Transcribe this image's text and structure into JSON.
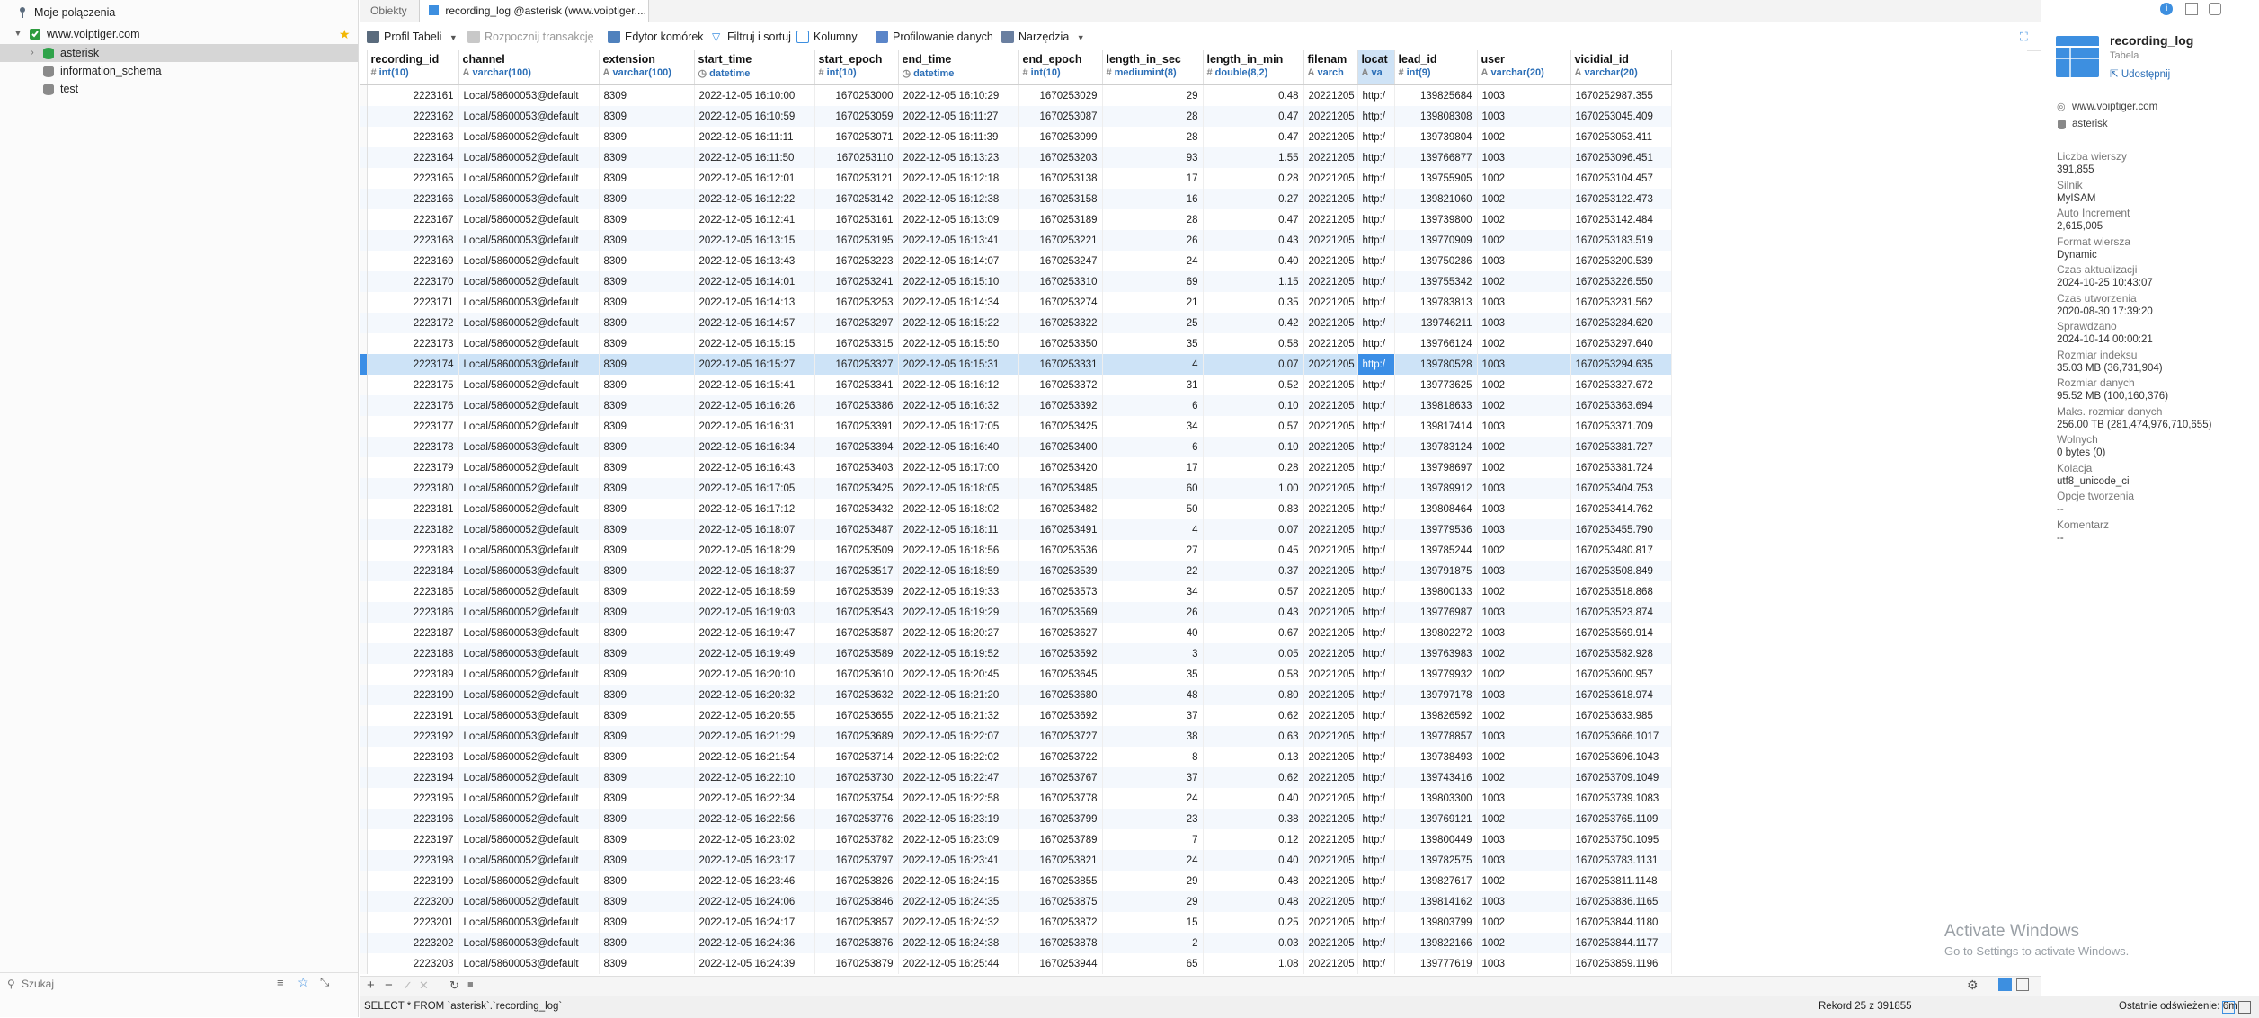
{
  "sidebar": {
    "header": "Moje połączenia",
    "connection": "www.voiptiger.com",
    "databases": [
      "asterisk",
      "information_schema",
      "test"
    ],
    "search_placeholder": "Szukaj"
  },
  "tabs": [
    "Obiekty",
    "recording_log @asterisk (www.voiptiger...."
  ],
  "toolbar": {
    "profile": "Profil Tabeli",
    "transaction": "Rozpocznij transakcję",
    "cell_editor": "Edytor komórek",
    "filter_sort": "Filtruj i sortuj",
    "columns": "Kolumny",
    "data_profiling": "Profilowanie danych",
    "tools": "Narzędzia"
  },
  "columns": [
    {
      "name": "recording_id",
      "type": "int(10)",
      "icon": "#"
    },
    {
      "name": "channel",
      "type": "varchar(100)",
      "icon": "A"
    },
    {
      "name": "extension",
      "type": "varchar(100)",
      "icon": "A"
    },
    {
      "name": "start_time",
      "type": "datetime",
      "icon": "◷"
    },
    {
      "name": "start_epoch",
      "type": "int(10)",
      "icon": "#"
    },
    {
      "name": "end_time",
      "type": "datetime",
      "icon": "◷"
    },
    {
      "name": "end_epoch",
      "type": "int(10)",
      "icon": "#"
    },
    {
      "name": "length_in_sec",
      "type": "mediumint(8)",
      "icon": "#"
    },
    {
      "name": "length_in_min",
      "type": "double(8,2)",
      "icon": "#"
    },
    {
      "name": "filenam",
      "type": "varch",
      "icon": "A"
    },
    {
      "name": "locat",
      "type": "va",
      "icon": "A"
    },
    {
      "name": "lead_id",
      "type": "int(9)",
      "icon": "#"
    },
    {
      "name": "user",
      "type": "varchar(20)",
      "icon": "A"
    },
    {
      "name": "vicidial_id",
      "type": "varchar(20)",
      "icon": "A"
    }
  ],
  "rows": [
    [
      "2223161",
      "Local/58600053@default",
      "8309",
      "2022-12-05 16:10:00",
      "1670253000",
      "2022-12-05 16:10:29",
      "1670253029",
      "29",
      "0.48",
      "20221205",
      "http:/",
      "139825684",
      "1003",
      "1670252987.355"
    ],
    [
      "2223162",
      "Local/58600053@default",
      "8309",
      "2022-12-05 16:10:59",
      "1670253059",
      "2022-12-05 16:11:27",
      "1670253087",
      "28",
      "0.47",
      "20221205",
      "http:/",
      "139808308",
      "1003",
      "1670253045.409"
    ],
    [
      "2223163",
      "Local/58600052@default",
      "8309",
      "2022-12-05 16:11:11",
      "1670253071",
      "2022-12-05 16:11:39",
      "1670253099",
      "28",
      "0.47",
      "20221205",
      "http:/",
      "139739804",
      "1002",
      "1670253053.411"
    ],
    [
      "2223164",
      "Local/58600052@default",
      "8309",
      "2022-12-05 16:11:50",
      "1670253110",
      "2022-12-05 16:13:23",
      "1670253203",
      "93",
      "1.55",
      "20221205",
      "http:/",
      "139766877",
      "1003",
      "1670253096.451"
    ],
    [
      "2223165",
      "Local/58600052@default",
      "8309",
      "2022-12-05 16:12:01",
      "1670253121",
      "2022-12-05 16:12:18",
      "1670253138",
      "17",
      "0.28",
      "20221205",
      "http:/",
      "139755905",
      "1002",
      "1670253104.457"
    ],
    [
      "2223166",
      "Local/58600053@default",
      "8309",
      "2022-12-05 16:12:22",
      "1670253142",
      "2022-12-05 16:12:38",
      "1670253158",
      "16",
      "0.27",
      "20221205",
      "http:/",
      "139821060",
      "1002",
      "1670253122.473"
    ],
    [
      "2223167",
      "Local/58600052@default",
      "8309",
      "2022-12-05 16:12:41",
      "1670253161",
      "2022-12-05 16:13:09",
      "1670253189",
      "28",
      "0.47",
      "20221205",
      "http:/",
      "139739800",
      "1002",
      "1670253142.484"
    ],
    [
      "2223168",
      "Local/58600053@default",
      "8309",
      "2022-12-05 16:13:15",
      "1670253195",
      "2022-12-05 16:13:41",
      "1670253221",
      "26",
      "0.43",
      "20221205",
      "http:/",
      "139770909",
      "1002",
      "1670253183.519"
    ],
    [
      "2223169",
      "Local/58600052@default",
      "8309",
      "2022-12-05 16:13:43",
      "1670253223",
      "2022-12-05 16:14:07",
      "1670253247",
      "24",
      "0.40",
      "20221205",
      "http:/",
      "139750286",
      "1003",
      "1670253200.539"
    ],
    [
      "2223170",
      "Local/58600052@default",
      "8309",
      "2022-12-05 16:14:01",
      "1670253241",
      "2022-12-05 16:15:10",
      "1670253310",
      "69",
      "1.15",
      "20221205",
      "http:/",
      "139755342",
      "1002",
      "1670253226.550"
    ],
    [
      "2223171",
      "Local/58600053@default",
      "8309",
      "2022-12-05 16:14:13",
      "1670253253",
      "2022-12-05 16:14:34",
      "1670253274",
      "21",
      "0.35",
      "20221205",
      "http:/",
      "139783813",
      "1003",
      "1670253231.562"
    ],
    [
      "2223172",
      "Local/58600052@default",
      "8309",
      "2022-12-05 16:14:57",
      "1670253297",
      "2022-12-05 16:15:22",
      "1670253322",
      "25",
      "0.42",
      "20221205",
      "http:/",
      "139746211",
      "1003",
      "1670253284.620"
    ],
    [
      "2223173",
      "Local/58600052@default",
      "8309",
      "2022-12-05 16:15:15",
      "1670253315",
      "2022-12-05 16:15:50",
      "1670253350",
      "35",
      "0.58",
      "20221205",
      "http:/",
      "139766124",
      "1002",
      "1670253297.640"
    ],
    [
      "2223174",
      "Local/58600053@default",
      "8309",
      "2022-12-05 16:15:27",
      "1670253327",
      "2022-12-05 16:15:31",
      "1670253331",
      "4",
      "0.07",
      "20221205",
      "http:/",
      "139780528",
      "1003",
      "1670253294.635"
    ],
    [
      "2223175",
      "Local/58600052@default",
      "8309",
      "2022-12-05 16:15:41",
      "1670253341",
      "2022-12-05 16:16:12",
      "1670253372",
      "31",
      "0.52",
      "20221205",
      "http:/",
      "139773625",
      "1002",
      "1670253327.672"
    ],
    [
      "2223176",
      "Local/58600052@default",
      "8309",
      "2022-12-05 16:16:26",
      "1670253386",
      "2022-12-05 16:16:32",
      "1670253392",
      "6",
      "0.10",
      "20221205",
      "http:/",
      "139818633",
      "1002",
      "1670253363.694"
    ],
    [
      "2223177",
      "Local/58600052@default",
      "8309",
      "2022-12-05 16:16:31",
      "1670253391",
      "2022-12-05 16:17:05",
      "1670253425",
      "34",
      "0.57",
      "20221205",
      "http:/",
      "139817414",
      "1003",
      "1670253371.709"
    ],
    [
      "2223178",
      "Local/58600053@default",
      "8309",
      "2022-12-05 16:16:34",
      "1670253394",
      "2022-12-05 16:16:40",
      "1670253400",
      "6",
      "0.10",
      "20221205",
      "http:/",
      "139783124",
      "1002",
      "1670253381.727"
    ],
    [
      "2223179",
      "Local/58600052@default",
      "8309",
      "2022-12-05 16:16:43",
      "1670253403",
      "2022-12-05 16:17:00",
      "1670253420",
      "17",
      "0.28",
      "20221205",
      "http:/",
      "139798697",
      "1002",
      "1670253381.724"
    ],
    [
      "2223180",
      "Local/58600052@default",
      "8309",
      "2022-12-05 16:17:05",
      "1670253425",
      "2022-12-05 16:18:05",
      "1670253485",
      "60",
      "1.00",
      "20221205",
      "http:/",
      "139789912",
      "1003",
      "1670253404.753"
    ],
    [
      "2223181",
      "Local/58600052@default",
      "8309",
      "2022-12-05 16:17:12",
      "1670253432",
      "2022-12-05 16:18:02",
      "1670253482",
      "50",
      "0.83",
      "20221205",
      "http:/",
      "139808464",
      "1003",
      "1670253414.762"
    ],
    [
      "2223182",
      "Local/58600052@default",
      "8309",
      "2022-12-05 16:18:07",
      "1670253487",
      "2022-12-05 16:18:11",
      "1670253491",
      "4",
      "0.07",
      "20221205",
      "http:/",
      "139779536",
      "1003",
      "1670253455.790"
    ],
    [
      "2223183",
      "Local/58600053@default",
      "8309",
      "2022-12-05 16:18:29",
      "1670253509",
      "2022-12-05 16:18:56",
      "1670253536",
      "27",
      "0.45",
      "20221205",
      "http:/",
      "139785244",
      "1002",
      "1670253480.817"
    ],
    [
      "2223184",
      "Local/58600053@default",
      "8309",
      "2022-12-05 16:18:37",
      "1670253517",
      "2022-12-05 16:18:59",
      "1670253539",
      "22",
      "0.37",
      "20221205",
      "http:/",
      "139791875",
      "1003",
      "1670253508.849"
    ],
    [
      "2223185",
      "Local/58600052@default",
      "8309",
      "2022-12-05 16:18:59",
      "1670253539",
      "2022-12-05 16:19:33",
      "1670253573",
      "34",
      "0.57",
      "20221205",
      "http:/",
      "139800133",
      "1002",
      "1670253518.868"
    ],
    [
      "2223186",
      "Local/58600052@default",
      "8309",
      "2022-12-05 16:19:03",
      "1670253543",
      "2022-12-05 16:19:29",
      "1670253569",
      "26",
      "0.43",
      "20221205",
      "http:/",
      "139776987",
      "1003",
      "1670253523.874"
    ],
    [
      "2223187",
      "Local/58600053@default",
      "8309",
      "2022-12-05 16:19:47",
      "1670253587",
      "2022-12-05 16:20:27",
      "1670253627",
      "40",
      "0.67",
      "20221205",
      "http:/",
      "139802272",
      "1003",
      "1670253569.914"
    ],
    [
      "2223188",
      "Local/58600053@default",
      "8309",
      "2022-12-05 16:19:49",
      "1670253589",
      "2022-12-05 16:19:52",
      "1670253592",
      "3",
      "0.05",
      "20221205",
      "http:/",
      "139763983",
      "1002",
      "1670253582.928"
    ],
    [
      "2223189",
      "Local/58600052@default",
      "8309",
      "2022-12-05 16:20:10",
      "1670253610",
      "2022-12-05 16:20:45",
      "1670253645",
      "35",
      "0.58",
      "20221205",
      "http:/",
      "139779932",
      "1002",
      "1670253600.957"
    ],
    [
      "2223190",
      "Local/58600052@default",
      "8309",
      "2022-12-05 16:20:32",
      "1670253632",
      "2022-12-05 16:21:20",
      "1670253680",
      "48",
      "0.80",
      "20221205",
      "http:/",
      "139797178",
      "1003",
      "1670253618.974"
    ],
    [
      "2223191",
      "Local/58600053@default",
      "8309",
      "2022-12-05 16:20:55",
      "1670253655",
      "2022-12-05 16:21:32",
      "1670253692",
      "37",
      "0.62",
      "20221205",
      "http:/",
      "139826592",
      "1002",
      "1670253633.985"
    ],
    [
      "2223192",
      "Local/58600053@default",
      "8309",
      "2022-12-05 16:21:29",
      "1670253689",
      "2022-12-05 16:22:07",
      "1670253727",
      "38",
      "0.63",
      "20221205",
      "http:/",
      "139778857",
      "1003",
      "1670253666.1017"
    ],
    [
      "2223193",
      "Local/58600052@default",
      "8309",
      "2022-12-05 16:21:54",
      "1670253714",
      "2022-12-05 16:22:02",
      "1670253722",
      "8",
      "0.13",
      "20221205",
      "http:/",
      "139738493",
      "1002",
      "1670253696.1043"
    ],
    [
      "2223194",
      "Local/58600052@default",
      "8309",
      "2022-12-05 16:22:10",
      "1670253730",
      "2022-12-05 16:22:47",
      "1670253767",
      "37",
      "0.62",
      "20221205",
      "http:/",
      "139743416",
      "1002",
      "1670253709.1049"
    ],
    [
      "2223195",
      "Local/58600052@default",
      "8309",
      "2022-12-05 16:22:34",
      "1670253754",
      "2022-12-05 16:22:58",
      "1670253778",
      "24",
      "0.40",
      "20221205",
      "http:/",
      "139803300",
      "1003",
      "1670253739.1083"
    ],
    [
      "2223196",
      "Local/58600052@default",
      "8309",
      "2022-12-05 16:22:56",
      "1670253776",
      "2022-12-05 16:23:19",
      "1670253799",
      "23",
      "0.38",
      "20221205",
      "http:/",
      "139769121",
      "1002",
      "1670253765.1109"
    ],
    [
      "2223197",
      "Local/58600052@default",
      "8309",
      "2022-12-05 16:23:02",
      "1670253782",
      "2022-12-05 16:23:09",
      "1670253789",
      "7",
      "0.12",
      "20221205",
      "http:/",
      "139800449",
      "1003",
      "1670253750.1095"
    ],
    [
      "2223198",
      "Local/58600052@default",
      "8309",
      "2022-12-05 16:23:17",
      "1670253797",
      "2022-12-05 16:23:41",
      "1670253821",
      "24",
      "0.40",
      "20221205",
      "http:/",
      "139782575",
      "1003",
      "1670253783.1131"
    ],
    [
      "2223199",
      "Local/58600052@default",
      "8309",
      "2022-12-05 16:23:46",
      "1670253826",
      "2022-12-05 16:24:15",
      "1670253855",
      "29",
      "0.48",
      "20221205",
      "http:/",
      "139827617",
      "1002",
      "1670253811.1148"
    ],
    [
      "2223200",
      "Local/58600052@default",
      "8309",
      "2022-12-05 16:24:06",
      "1670253846",
      "2022-12-05 16:24:35",
      "1670253875",
      "29",
      "0.48",
      "20221205",
      "http:/",
      "139814162",
      "1003",
      "1670253836.1165"
    ],
    [
      "2223201",
      "Local/58600053@default",
      "8309",
      "2022-12-05 16:24:17",
      "1670253857",
      "2022-12-05 16:24:32",
      "1670253872",
      "15",
      "0.25",
      "20221205",
      "http:/",
      "139803799",
      "1002",
      "1670253844.1180"
    ],
    [
      "2223202",
      "Local/58600053@default",
      "8309",
      "2022-12-05 16:24:36",
      "1670253876",
      "2022-12-05 16:24:38",
      "1670253878",
      "2",
      "0.03",
      "20221205",
      "http:/",
      "139822166",
      "1002",
      "1670253844.1177"
    ],
    [
      "2223203",
      "Local/58600053@default",
      "8309",
      "2022-12-05 16:24:39",
      "1670253879",
      "2022-12-05 16:25:44",
      "1670253944",
      "65",
      "1.08",
      "20221205",
      "http:/",
      "139777619",
      "1003",
      "1670253859.1196"
    ]
  ],
  "selected_row_index": 13,
  "cursor_column_index": 10,
  "status_bar": {
    "query": "SELECT * FROM `asterisk`.`recording_log`",
    "record": "Rekord 25 z 391855",
    "refresh": "Ostatnie odświeżenie: 6m"
  },
  "panel": {
    "title": "recording_log",
    "subtitle": "Tabela",
    "share": "Udostępnij",
    "server": "www.voiptiger.com",
    "database": "asterisk",
    "props": [
      {
        "label": "Liczba wierszy",
        "value": "391,855"
      },
      {
        "label": "Silnik",
        "value": "MyISAM"
      },
      {
        "label": "Auto Increment",
        "value": "2,615,005"
      },
      {
        "label": "Format wiersza",
        "value": "Dynamic"
      },
      {
        "label": "Czas aktualizacji",
        "value": "2024-10-25 10:43:07"
      },
      {
        "label": "Czas utworzenia",
        "value": "2020-08-30 17:39:20"
      },
      {
        "label": "Sprawdzano",
        "value": "2024-10-14 00:00:21"
      },
      {
        "label": "Rozmiar indeksu",
        "value": "35.03 MB (36,731,904)"
      },
      {
        "label": "Rozmiar danych",
        "value": "95.52 MB (100,160,376)"
      },
      {
        "label": "Maks. rozmiar danych",
        "value": "256.00 TB (281,474,976,710,655)"
      },
      {
        "label": "Wolnych",
        "value": "0 bytes (0)"
      },
      {
        "label": "Kolacja",
        "value": "utf8_unicode_ci"
      },
      {
        "label": "Opcje tworzenia",
        "value": "--"
      },
      {
        "label": "Komentarz",
        "value": "--"
      }
    ]
  },
  "watermark": {
    "title": "Activate Windows",
    "subtitle": "Go to Settings to activate Windows."
  },
  "colors": {
    "selection": "#cde3f7",
    "cursor_cell": "#3b8ee6",
    "type_text": "#2c6fb7",
    "panel_icon": "#3d8fe0",
    "star": "#f2b705"
  }
}
